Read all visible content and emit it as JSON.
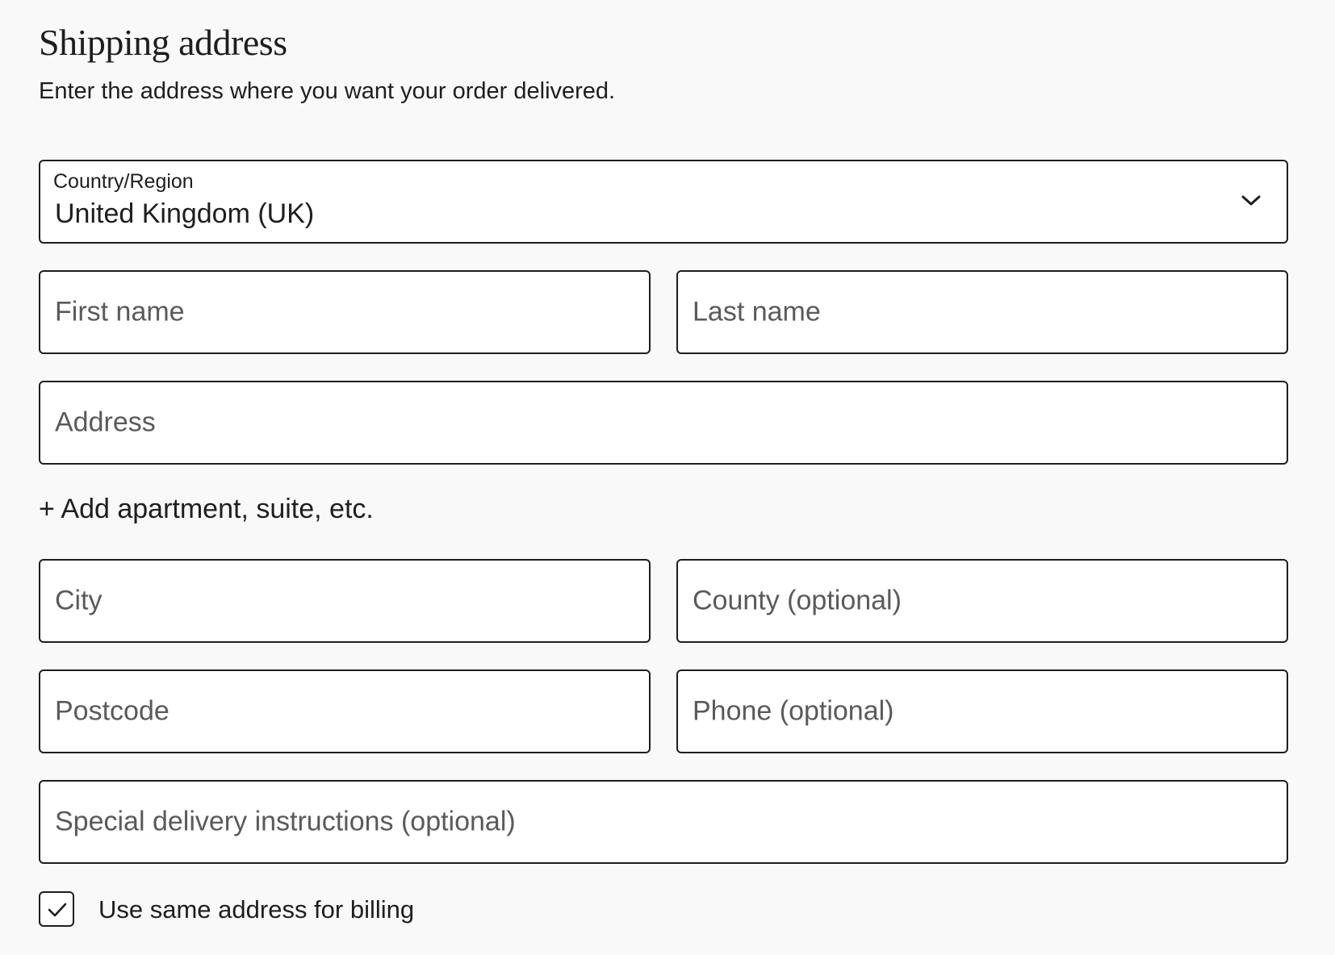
{
  "section": {
    "title": "Shipping address",
    "subtitle": "Enter the address where you want your order delivered."
  },
  "country_select": {
    "label": "Country/Region",
    "value": "United Kingdom (UK)",
    "icon": "chevron-down-icon"
  },
  "fields": {
    "first_name": "First name",
    "last_name": "Last name",
    "address": "Address",
    "add_apartment": "+ Add apartment, suite, etc.",
    "city": "City",
    "county": "County (optional)",
    "postcode": "Postcode",
    "phone": "Phone (optional)",
    "delivery_instructions": "Special delivery instructions (optional)"
  },
  "billing_checkbox": {
    "label": "Use same address for billing",
    "checked": true,
    "icon": "checkmark-icon"
  },
  "colors": {
    "background": "#f9f9f9",
    "border": "#1e1e1e",
    "placeholder": "#5a5a5a",
    "text": "#1e1e1e"
  }
}
